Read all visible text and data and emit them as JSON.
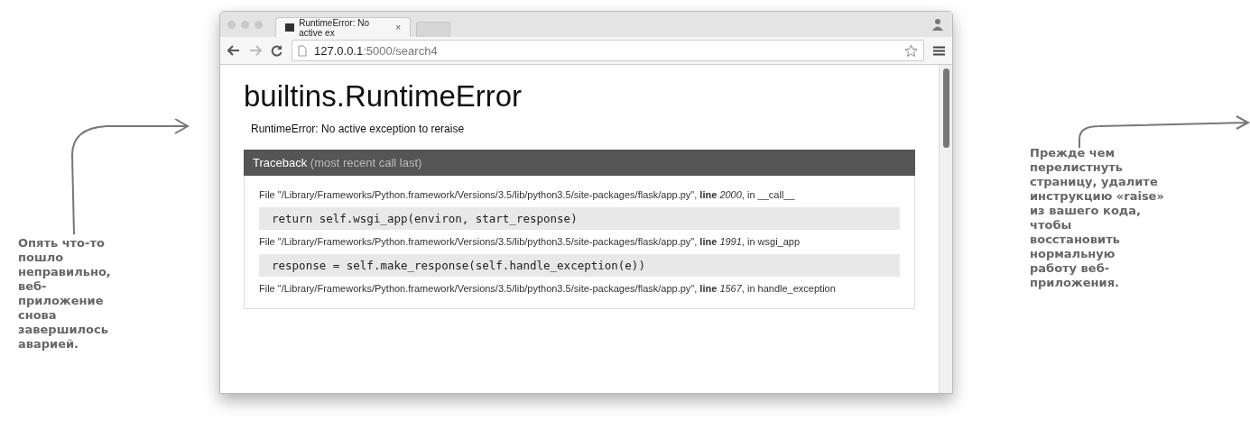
{
  "browser": {
    "tab": {
      "title": "RuntimeError: No active ex",
      "close": "×"
    },
    "address": {
      "host": "127.0.0.1",
      "path": ":5000/search4"
    }
  },
  "page": {
    "heading": "builtins.RuntimeError",
    "message": "RuntimeError: No active exception to reraise",
    "traceback": {
      "title": "Traceback",
      "subtitle": "(most recent call last)",
      "frames": [
        {
          "location": "File \"/Library/Frameworks/Python.framework/Versions/3.5/lib/python3.5/site-packages/flask/app.py\", **line** *2000*, in __call__",
          "code": "return self.wsgi_app(environ, start_response)"
        },
        {
          "location": "File \"/Library/Frameworks/Python.framework/Versions/3.5/lib/python3.5/site-packages/flask/app.py\", **line** *1991*, in wsgi_app",
          "code": "response = self.make_response(self.handle_exception(e))"
        },
        {
          "location": "File \"/Library/Frameworks/Python.framework/Versions/3.5/lib/python3.5/site-packages/flask/app.py\", **line** *1567*, in handle_exception"
        }
      ]
    }
  },
  "annotations": {
    "left": "Опять что-то пошло неправильно, веб-приложение снова завершилось аварией.",
    "right": "Прежде чем перелистнуть страницу, удалите инструкцию «raise» из вашего кода, чтобы восстановить нормальную работу веб-приложения."
  }
}
